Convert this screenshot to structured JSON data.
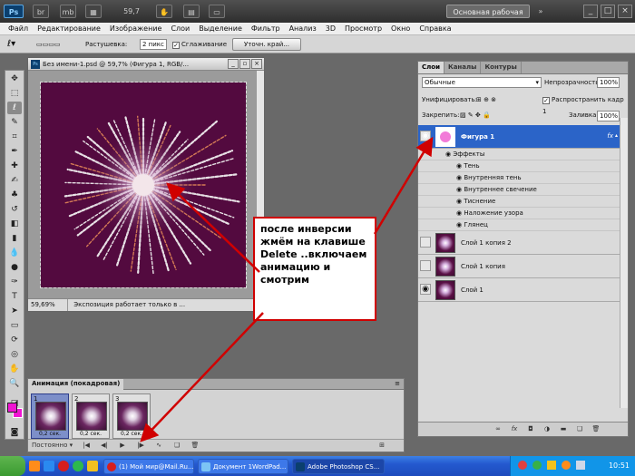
{
  "appbar": {
    "workspace": "Основная рабочая среда",
    "zoom": "59,7",
    "logo": "Ps",
    "icons": [
      "mb",
      "br"
    ]
  },
  "menu": [
    "Файл",
    "Редактирование",
    "Изображение",
    "Слои",
    "Выделение",
    "Фильтр",
    "Анализ",
    "3D",
    "Просмотр",
    "Окно",
    "Справка"
  ],
  "options": {
    "feather_label": "Растушевка:",
    "feather_value": "2 пикс",
    "antialias": "Сглаживание",
    "refine_button": "Уточн. край..."
  },
  "document": {
    "title": "Без имени-1.psd @ 59,7% (Фигура 1, RGB/...",
    "zoom": "59,69%",
    "status": "Экспозиция работает только в ..."
  },
  "callout": {
    "text": "после инверсии жмём на клавише Delete ..включаем анимацию и смотрим"
  },
  "layers_panel": {
    "tabs": [
      "Слои",
      "Каналы",
      "Контуры"
    ],
    "blend_mode": "Обычные",
    "opacity_label": "Непрозрачность:",
    "opacity_value": "100%",
    "unify_label": "Унифицировать:",
    "propagate_label": "Распространить кадр 1",
    "lock_label": "Закрепить:",
    "fill_label": "Заливка:",
    "fill_value": "100%",
    "selected_layer": "Фигура 1",
    "fx_symbol": "fx",
    "effects_label": "Эффекты",
    "effects": [
      "Тень",
      "Внутренняя тень",
      "Внутреннее свечение",
      "Тиснение",
      "Наложение узора",
      "Глянец"
    ],
    "layers": [
      "Слой 1 копия 2",
      "Слой 1 копия",
      "Слой 1"
    ]
  },
  "animation": {
    "tab": "Анимация (покадровая)",
    "frames": [
      {
        "num": "1",
        "delay": "0,2 сек."
      },
      {
        "num": "2",
        "delay": "0,2 сек."
      },
      {
        "num": "3",
        "delay": "0,2 сек."
      }
    ],
    "loop": "Постоянно"
  },
  "taskbar": {
    "tasks": [
      "(1) Мой мир@Mail.Ru....",
      "Документ 1WordPad...",
      "Adobe Photoshop CS..."
    ],
    "clock": "10:51"
  },
  "colors": {
    "foreground": "#f014d2",
    "background": "#f014d2",
    "canvas": "#530a3f",
    "selected_layer": "#2b64c8",
    "callout_border": "#d00000"
  }
}
